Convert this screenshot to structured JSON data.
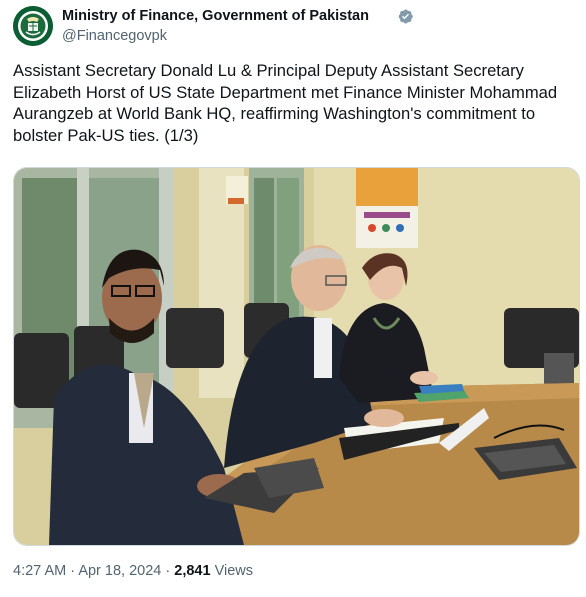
{
  "author": {
    "name": "Ministry of Finance, Government of Pakistan",
    "handle": "@Financegovpk",
    "verified_color": "#829aab",
    "avatar_color": "#0b5e34"
  },
  "tweet": {
    "text": "Assistant Secretary Donald Lu & Principal Deputy Assistant Secretary Elizabeth Horst of US State Department met Finance Minister Mohammad Aurangzeb at World Bank HQ, reaffirming Washington's commitment to bolster Pak-US ties. (1/3)"
  },
  "meta": {
    "time": "4:27 AM",
    "separator": "·",
    "date": "Apr 18, 2024",
    "views_count": "2,841",
    "views_label": "Views"
  },
  "photo": {
    "alt_icon": "meeting-photo"
  }
}
